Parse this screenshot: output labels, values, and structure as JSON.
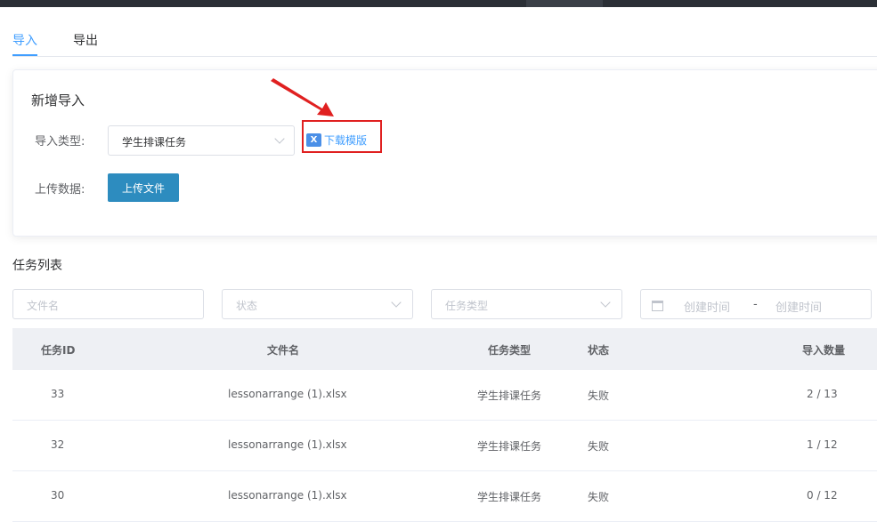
{
  "tabs": [
    {
      "label": "导入"
    },
    {
      "label": "导出"
    }
  ],
  "new_import": {
    "title": "新增导入",
    "type_label": "导入类型:",
    "type_value": "学生排课任务",
    "download_label": "下载模版",
    "download_icon": "excel-icon",
    "upload_label": "上传数据:",
    "upload_button": "上传文件"
  },
  "task_list": {
    "title": "任务列表",
    "filters": {
      "filename_placeholder": "文件名",
      "status_placeholder": "状态",
      "type_placeholder": "任务类型",
      "start_date_placeholder": "创建时间",
      "date_separator": "-",
      "end_date_placeholder": "创建时间"
    },
    "columns": [
      "任务ID",
      "文件名",
      "任务类型",
      "状态",
      "导入数量"
    ],
    "rows": [
      {
        "id": "33",
        "file": "lessonarrange (1).xlsx",
        "type": "学生排课任务",
        "status": "失败",
        "count": "2 / 13"
      },
      {
        "id": "32",
        "file": "lessonarrange (1).xlsx",
        "type": "学生排课任务",
        "status": "失败",
        "count": "1 / 12"
      },
      {
        "id": "30",
        "file": "lessonarrange (1).xlsx",
        "type": "学生排课任务",
        "status": "失败",
        "count": "0 / 12"
      }
    ]
  },
  "colors": {
    "accent": "#409eff",
    "upload_button": "#2d8cbf",
    "highlight": "#e02020"
  }
}
